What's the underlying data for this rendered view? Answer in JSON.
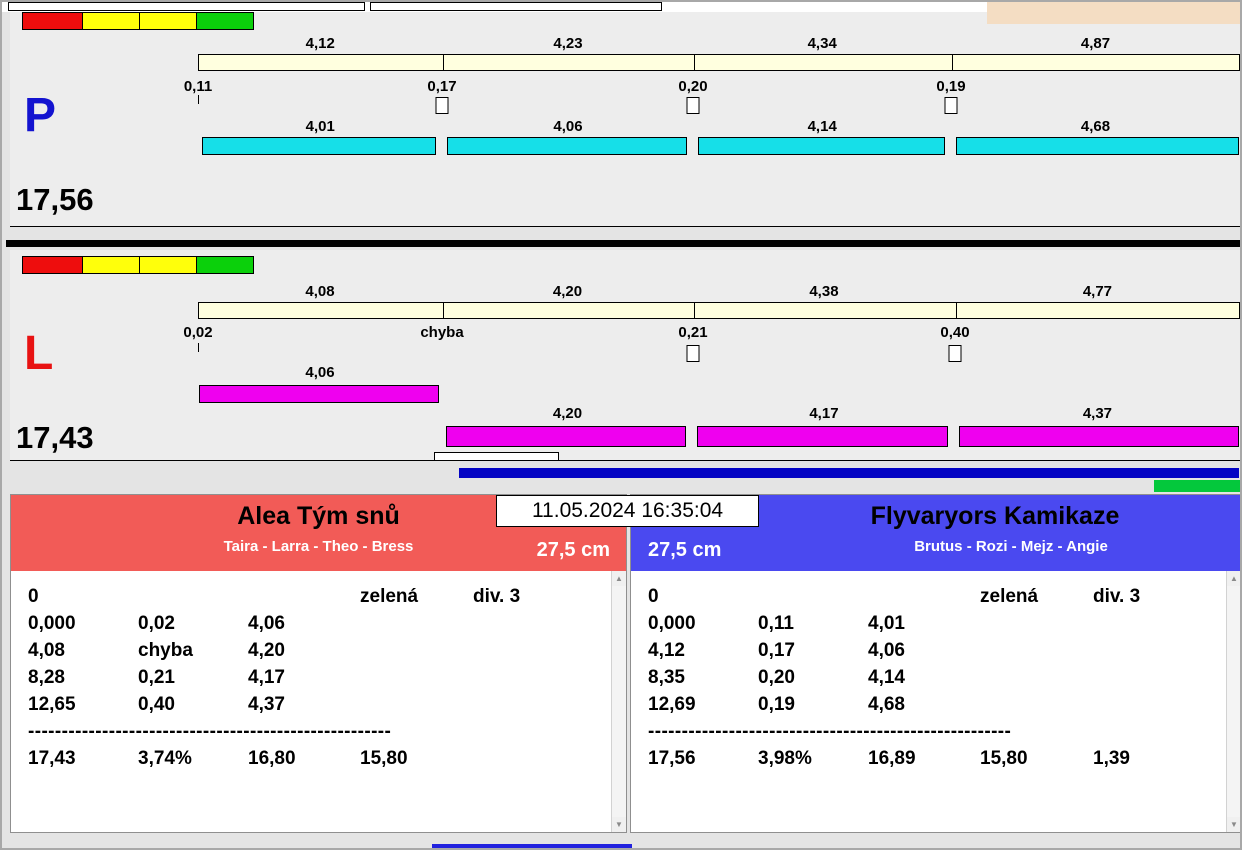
{
  "icons": {
    "scroll_up": "▲",
    "scroll_down": "▼"
  },
  "colors": {
    "red_team_header": "#f25b57",
    "blue_team_header": "#4a49f0",
    "cyan_run_bar": "#16dfe8",
    "magenta_run_bar": "#ef00ef",
    "split_axis_bar": "#ffffdf",
    "p_letter": "#1313d0",
    "l_letter": "#e81212",
    "timeline_bar": "#0404c4",
    "status_green_bar": "#04c83c",
    "status_blocks": [
      "#ee0d0d",
      "#ffff0b",
      "#ffff0b",
      "#0bd00b"
    ]
  },
  "timestamp": "11.05.2024 16:35:04",
  "lanes": [
    {
      "letter": "P",
      "total": "17,56",
      "splits": [
        "4,12",
        "4,23",
        "4,34",
        "4,87"
      ],
      "reactions": [
        "0,11",
        "0,17",
        "0,20",
        "0,19"
      ],
      "runs": [
        "4,01",
        "4,06",
        "4,14",
        "4,68"
      ]
    },
    {
      "letter": "L",
      "total": "17,43",
      "splits": [
        "4,08",
        "4,20",
        "4,38",
        "4,77"
      ],
      "reactions": [
        "0,02",
        "chyba",
        "0,21",
        "0,40"
      ],
      "run_first": "4,06",
      "runs": [
        "4,20",
        "4,17",
        "4,37"
      ]
    }
  ],
  "teams": [
    {
      "name": "Alea Tým snů",
      "members": "Taira - Larra - Theo - Bress",
      "jump_height": "27,5 cm",
      "rows": [
        [
          "0",
          "",
          "",
          "zelená",
          "div. 3"
        ],
        [
          "0,000",
          "0,02",
          "4,06",
          "",
          ""
        ],
        [
          "4,08",
          "chyba",
          "4,20",
          "",
          ""
        ],
        [
          "8,28",
          "0,21",
          "4,17",
          "",
          ""
        ],
        [
          "12,65",
          "0,40",
          "4,37",
          "",
          ""
        ]
      ],
      "separator": "------------------------------------------------------",
      "totals": [
        "17,43",
        "3,74%",
        "16,80",
        "15,80",
        ""
      ]
    },
    {
      "name": "Flyvaryors Kamikaze",
      "members": "Brutus - Rozi - Mejz - Angie",
      "jump_height": "27,5 cm",
      "rows": [
        [
          "0",
          "",
          "",
          "zelená",
          "div. 3"
        ],
        [
          "0,000",
          "0,11",
          "4,01",
          "",
          ""
        ],
        [
          "4,12",
          "0,17",
          "4,06",
          "",
          ""
        ],
        [
          "8,35",
          "0,20",
          "4,14",
          "",
          ""
        ],
        [
          "12,69",
          "0,19",
          "4,68",
          "",
          ""
        ]
      ],
      "separator": "------------------------------------------------------",
      "totals": [
        "17,56",
        "3,98%",
        "16,89",
        "15,80",
        "1,39"
      ]
    }
  ]
}
